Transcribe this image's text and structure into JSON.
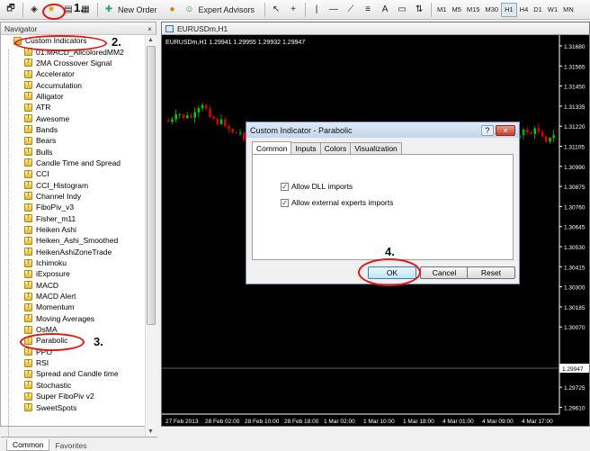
{
  "toolbar": {
    "new_order": "New Order",
    "expert_advisors": "Expert Advisors",
    "timeframes": [
      "M1",
      "M5",
      "M15",
      "M30",
      "H1",
      "H4",
      "D1",
      "W1",
      "MN"
    ]
  },
  "navigator": {
    "title": "Navigator",
    "close": "×",
    "root": "Custom Indicators",
    "items": [
      "01.MACD_AllcoloredMM2",
      "2MA Crossover Signal",
      "Accelerator",
      "Accumulation",
      "Alligator",
      "ATR",
      "Awesome",
      "Bands",
      "Bears",
      "Bulls",
      "Candle Time and Spread",
      "CCI",
      "CCI_Histogram",
      "Channel Indy",
      "FiboPiv_v3",
      "Fisher_m11",
      "Heiken Ashi",
      "Heiken_Ashi_Smoothed",
      "HeikenAshiZoneTrade",
      "Ichimoku",
      "iExposure",
      "MACD",
      "MACD Alert",
      "Momentum",
      "Moving Averages",
      "OsMA",
      "Parabolic",
      "PPO",
      "RSI",
      "Spread and Candle time",
      "Stochastic",
      "Super FiboPiv v2",
      "SweetSpots"
    ],
    "tabs": [
      "Common",
      "Favorites"
    ]
  },
  "chart": {
    "tab": "EURUSDm,H1",
    "info": "EURUSDm,H1  1.29941 1.29955 1.29932 1.29947",
    "current_price": "1.29947",
    "price_labels": [
      "1.31680",
      "1.31565",
      "1.31450",
      "1.31335",
      "1.31220",
      "1.31105",
      "1.30990",
      "1.30875",
      "1.30760",
      "1.30645",
      "1.30530",
      "1.30415",
      "1.30300",
      "1.30185",
      "1.30070",
      "1.29840",
      "1.29725",
      "1.29610"
    ],
    "time_labels": [
      "27 Feb 2013",
      "28 Feb 02:00",
      "28 Feb 10:00",
      "28 Feb 18:00",
      "1 Mar 02:00",
      "1 Mar 10:00",
      "1 Mar 18:00",
      "4 Mar 01:00",
      "4 Mar 09:00",
      "4 Mar 17:00"
    ]
  },
  "dialog": {
    "title": "Custom Indicator - Parabolic",
    "help": "?",
    "close": "×",
    "tabs": [
      "Common",
      "Inputs",
      "Colors",
      "Visualization"
    ],
    "allow_dll": "Allow DLL imports",
    "allow_external": "Allow external experts imports",
    "ok": "OK",
    "cancel": "Cancel",
    "reset": "Reset"
  },
  "annotations": {
    "step1": "1.",
    "step2": "2.",
    "step3": "3.",
    "step4": "4."
  },
  "colors": {
    "bull": "#00d000",
    "bear": "#e00000",
    "highlight": "#e01818"
  }
}
